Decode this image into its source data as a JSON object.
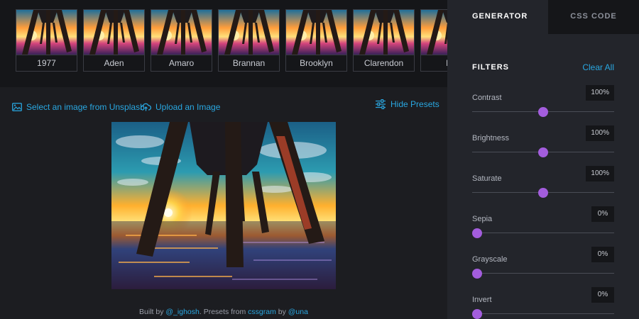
{
  "presets": {
    "items": [
      {
        "label": "1977"
      },
      {
        "label": "Aden"
      },
      {
        "label": "Amaro"
      },
      {
        "label": "Brannan"
      },
      {
        "label": "Brooklyn"
      },
      {
        "label": "Clarendon"
      },
      {
        "label": "Ea"
      }
    ]
  },
  "actions": {
    "unsplash_label": "Select an image from Unsplash",
    "upload_label": "Upload an Image",
    "hide_presets_label": "Hide Presets"
  },
  "credits": {
    "prefix": "Built by",
    "author": "@_ighosh",
    "middle": ". Presets from",
    "source": "cssgram",
    "by": "by",
    "source_author": "@una"
  },
  "tabs": {
    "generator": "GENERATOR",
    "css_code": "CSS CODE"
  },
  "filters": {
    "title": "FILTERS",
    "clear_label": "Clear All",
    "items": [
      {
        "name": "Contrast",
        "value": "100%",
        "level": 0.5
      },
      {
        "name": "Brightness",
        "value": "100%",
        "level": 0.5
      },
      {
        "name": "Saturate",
        "value": "100%",
        "level": 0.5
      },
      {
        "name": "Sepia",
        "value": "0%",
        "level": 0
      },
      {
        "name": "Grayscale",
        "value": "0%",
        "level": 0
      },
      {
        "name": "Invert",
        "value": "0%",
        "level": 0
      }
    ]
  },
  "colors": {
    "accent": "#29a7e1",
    "slider_thumb": "#a35ddd",
    "panel_bg": "#23252b",
    "page_bg": "#1c1d21"
  }
}
